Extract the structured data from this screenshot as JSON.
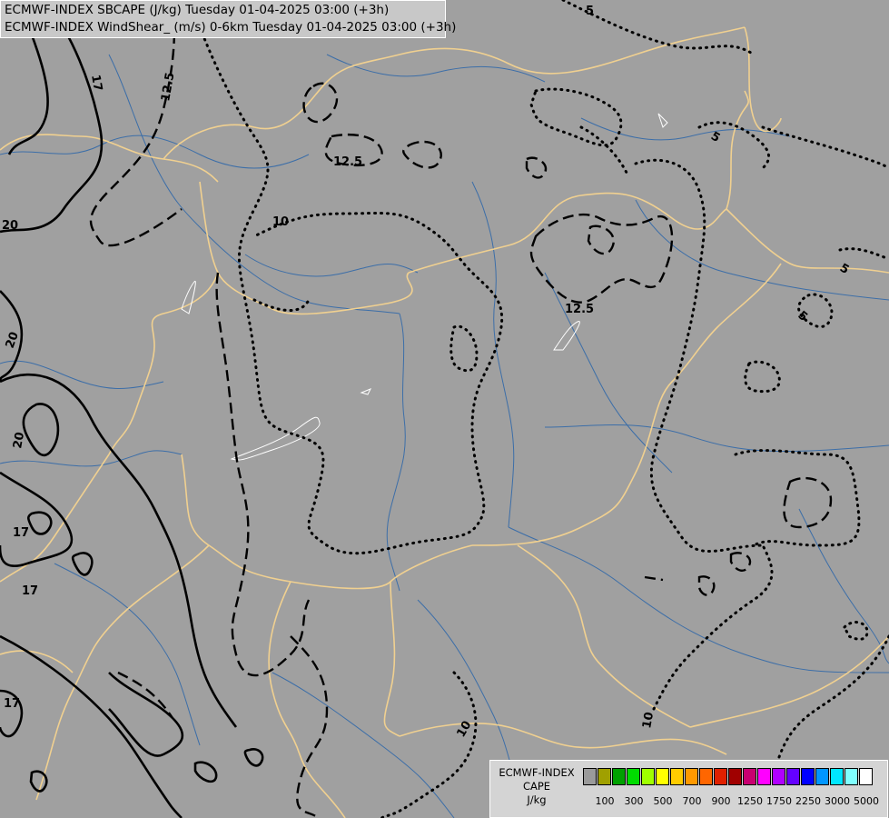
{
  "titles": {
    "line1": "ECMWF-INDEX SBCAPE (J/kg) Tuesday 01-04-2025 03:00 (+3h)",
    "line2": "ECMWF-INDEX WindShear_ (m/s) 0-6km Tuesday 01-04-2025 03:00 (+3h)"
  },
  "legend": {
    "line1": "ECMWF-INDEX",
    "line2": "CAPE",
    "line3": "J/kg",
    "colors": [
      "#9a9a9a",
      "#a0a000",
      "#00a000",
      "#00dc00",
      "#a0ff00",
      "#ffff00",
      "#ffcc00",
      "#ff9900",
      "#ff6600",
      "#e02000",
      "#a00000",
      "#c80070",
      "#ff00ff",
      "#b000ff",
      "#6400ff",
      "#0000ff",
      "#0096ff",
      "#00e6ff",
      "#80ffff",
      "#ffffff"
    ],
    "ticks": [
      "100",
      "300",
      "500",
      "700",
      "900",
      "1250",
      "1750",
      "2250",
      "3000",
      "5000"
    ]
  },
  "contour_labels": {
    "l1": "17",
    "l2": "12.5",
    "l3": "12.5",
    "l4": "10",
    "l5": "20",
    "l6": "20",
    "l7": "20",
    "l8": "17",
    "l9": "17",
    "l10": "17",
    "l11": "12.5",
    "l12": "5",
    "l13": "5",
    "l14": "5",
    "l15": "5",
    "l16": "10",
    "l17": "10"
  },
  "map_colors": {
    "background": "#a0a0a0",
    "borders": "#f0d090",
    "rivers": "#3c6ea8",
    "contours": "#000000"
  }
}
